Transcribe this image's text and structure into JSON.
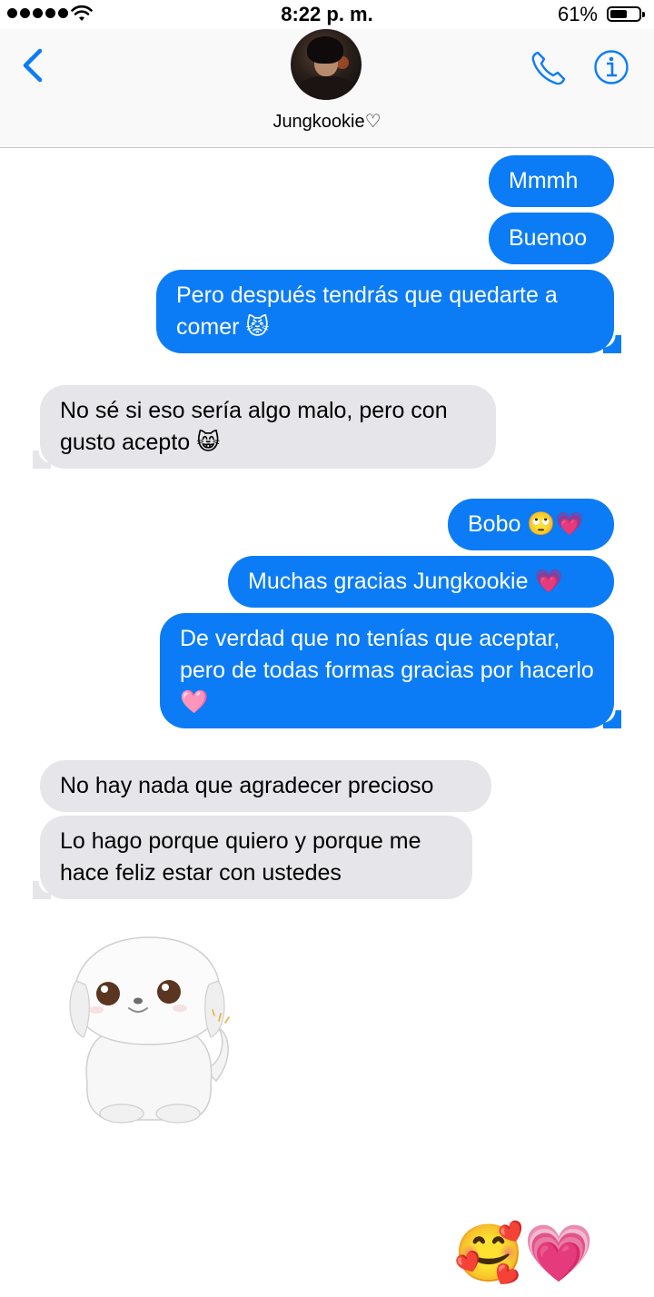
{
  "status_bar": {
    "time": "8:22 p. m.",
    "battery_percent": "61%",
    "battery_level": 0.61,
    "signal_bars": 5
  },
  "header": {
    "contact_name": "Jungkookie♡",
    "back_icon": "chevron-left-icon",
    "call_icon": "phone-icon",
    "info_icon": "info-icon",
    "accent_color": "#0b7cf6"
  },
  "messages": [
    {
      "from": "me",
      "text": "Mmmh"
    },
    {
      "from": "me",
      "text": "Buenoo"
    },
    {
      "from": "me",
      "text": "Pero después tendrás que quedarte a comer 😾"
    },
    {
      "from": "them",
      "text": "No sé si eso sería algo malo, pero con gusto acepto 😸"
    },
    {
      "from": "me",
      "text": "Bobo 🙄💗"
    },
    {
      "from": "me",
      "text": "Muchas gracias Jungkookie 💗"
    },
    {
      "from": "me",
      "text": "De verdad que no tenías que aceptar, pero de todas formas gracias por hacerlo 🩷"
    },
    {
      "from": "them",
      "text": "No hay nada que agradecer precioso"
    },
    {
      "from": "them",
      "text": "Lo hago porque quiero y porque me hace feliz estar con ustedes"
    },
    {
      "from": "them",
      "type": "sticker",
      "icon": "white-puppy-sticker"
    },
    {
      "from": "me",
      "type": "big-emoji",
      "text": "🥰💗"
    }
  ],
  "colors": {
    "outgoing_bubble": "#0b7cf6",
    "incoming_bubble": "#e5e5ea"
  }
}
